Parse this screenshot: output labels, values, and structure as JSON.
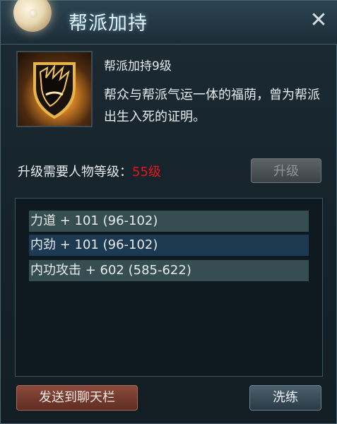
{
  "window": {
    "title": "帮派加持",
    "close_icon": "close-icon"
  },
  "skill": {
    "icon": "guild-banner-icon",
    "name": "帮派加持9级",
    "description": "帮众与帮派气运一体的福荫，曾为帮派出生入死的证明。"
  },
  "requirement": {
    "label": "升级需要人物等级：",
    "level": "55级",
    "level_color": "#e5151c"
  },
  "buttons": {
    "upgrade": "升级",
    "send_to_chat": "发送到聊天栏",
    "wash": "洗练"
  },
  "stats": [
    "力道 + 101 (96-102)",
    "内劲 + 101 (96-102)",
    "内功攻击 + 602 (585-622)"
  ]
}
